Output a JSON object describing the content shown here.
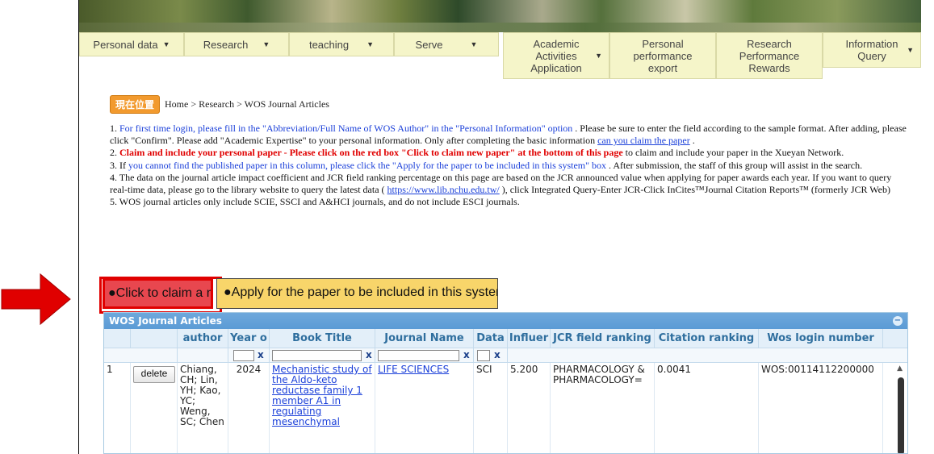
{
  "nav": {
    "items": [
      {
        "label": "Personal data"
      },
      {
        "label": "Research"
      },
      {
        "label": "teaching"
      },
      {
        "label": "Serve"
      },
      {
        "label": "Academic Activities Application"
      },
      {
        "label": "Personal performance export"
      },
      {
        "label": "Research Performance Rewards"
      },
      {
        "label": "Information Query"
      }
    ]
  },
  "location": {
    "badge": "現在位置",
    "breadcrumb": "Home > Research > WOS Journal Articles"
  },
  "notes": {
    "n1_prefix": "1. ",
    "n1_blue": "For first time login, please fill in the \"Abbreviation/Full Name of WOS Author\" in the \"Personal Information\" option",
    "n1_rest": " . Please be sure to enter the field according to the sample format. After adding, please click \"Confirm\". Please add \"Academic Expertise\" to your personal information. Only after completing the basic information ",
    "n1_link": "can you claim the paper",
    "n1_end": " .",
    "n2_prefix": "2. ",
    "n2_red": "Claim and include your personal paper - Please click on the red box \"Click to claim new paper\" at the bottom of this page",
    "n2_rest": " to claim and include your paper in the Xueyan Network.",
    "n3_prefix": "3. If ",
    "n3_blue": "you cannot find the published paper in this column, please click the \"Apply for the paper to be included in this system\" box",
    "n3_rest": " . After submission, the staff of this group will assist in the search.",
    "n4_text": "4. The data on the journal article impact coefficient and JCR field ranking percentage on this page are based on the JCR announced value when applying for paper awards each year. If you want to query real-time data, please go to the library website to query the latest data ( ",
    "n4_link": "https://www.lib.nchu.edu.tw/",
    "n4_rest": " ), click Integrated Query-Enter JCR-Click InCites™Journal Citation Reports™ (formerly JCR Web)",
    "n5_text": "5. WOS journal articles only include SCIE, SSCI and A&HCI journals, and do not include ESCI journals."
  },
  "buttons": {
    "claim": "●Click to claim a new paper",
    "apply": "●Apply for the paper to be included in this system"
  },
  "grid": {
    "caption": "WOS Journal Articles",
    "columns": [
      "author",
      "Year o",
      "Book Title",
      "Journal Name",
      "Data",
      "Influer",
      "JCR field ranking",
      "Citation ranking",
      "Wos login number"
    ],
    "filter_x": "x",
    "row": {
      "index": "1",
      "delete_label": "delete",
      "author": "Chiang, CH; Lin, YH; Kao, YC; Weng, SC; Chen",
      "year": "2024",
      "title": "Mechanistic study of the Aldo-keto reductase family 1 member A1 in regulating mesenchymal",
      "journal": "LIFE SCIENCES",
      "data": "SCI",
      "influence": "5.200",
      "jcr": "PHARMACOLOGY & PHARMACOLOGY=",
      "citation": "0.0041",
      "wos": "WOS:00114112200000"
    }
  },
  "colors": {
    "nav_bg": "#f5f5c9",
    "claim_bg": "#e8474f",
    "apply_bg": "#f8d56a",
    "grid_header": "#5b9bd5",
    "arrow": "#e00000"
  }
}
